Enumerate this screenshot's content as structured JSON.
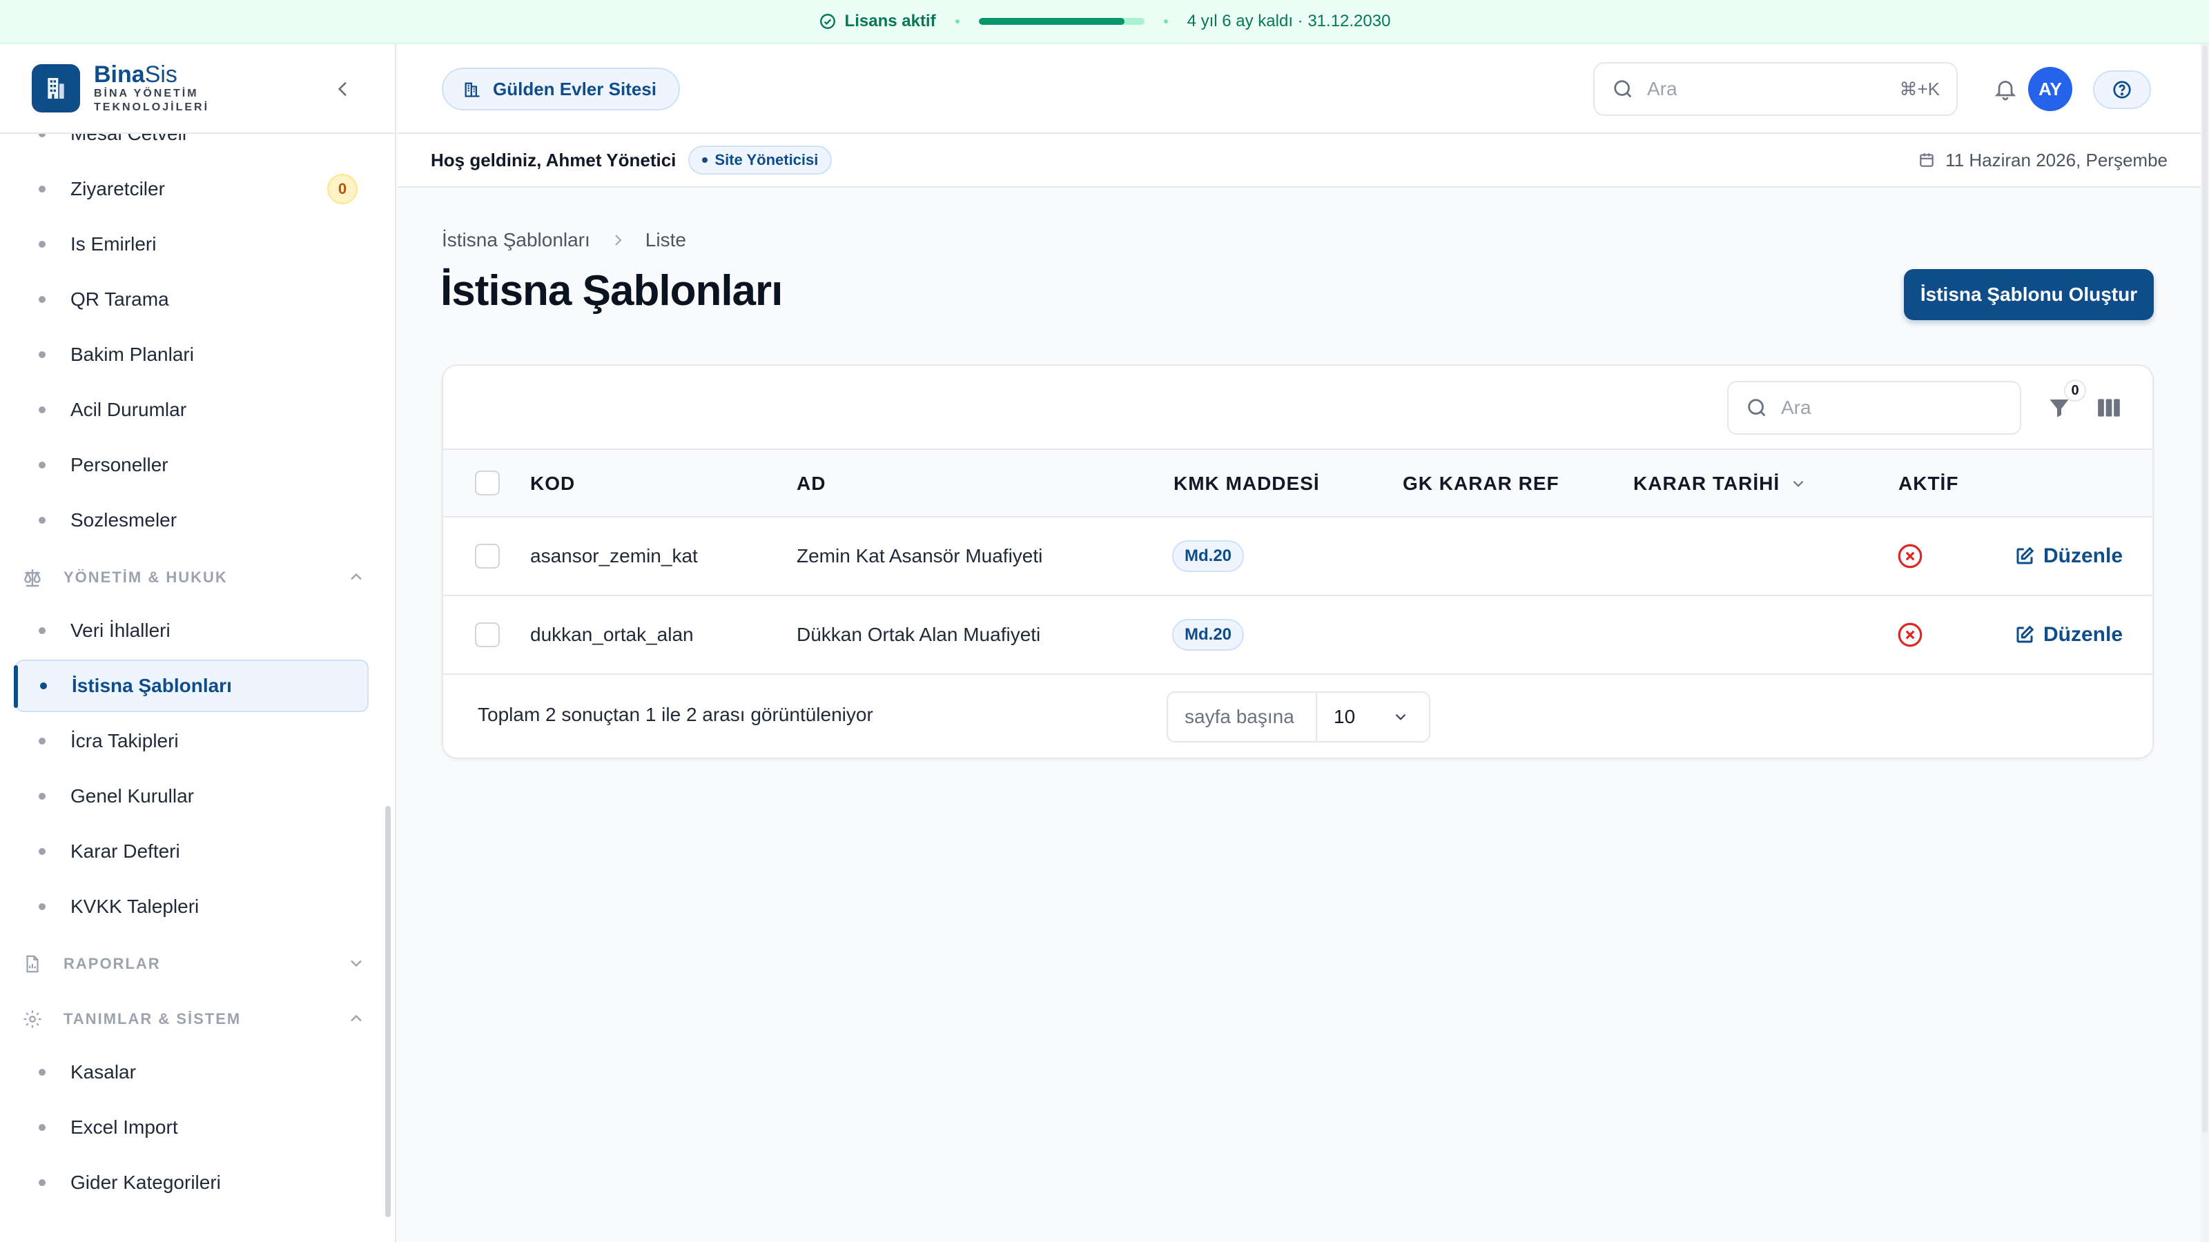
{
  "license": {
    "status": "Lisans aktif",
    "remaining": "4 yıl 6 ay kaldı · 31.12.2030",
    "progress_fraction": 0.88
  },
  "brand": {
    "name_bold": "Bina",
    "name_light": "Sis",
    "subtitle_line1": "BİNA YÖNETİM",
    "subtitle_line2": "TEKNOLOJİLERİ"
  },
  "sidebar": {
    "top_items": [
      {
        "label": "Mesai Cetveli"
      },
      {
        "label": "Ziyaretciler",
        "badge": "0"
      },
      {
        "label": "Is Emirleri"
      },
      {
        "label": "QR Tarama"
      },
      {
        "label": "Bakim Planlari"
      },
      {
        "label": "Acil Durumlar"
      },
      {
        "label": "Personeller"
      },
      {
        "label": "Sozlesmeler"
      }
    ],
    "section_yonetim": "YÖNETİM & HUKUK",
    "yonetim_items": [
      {
        "label": "Veri İhlalleri"
      },
      {
        "label": "İstisna Şablonları",
        "active": true
      },
      {
        "label": "İcra Takipleri"
      },
      {
        "label": "Genel Kurullar"
      },
      {
        "label": "Karar Defteri"
      },
      {
        "label": "KVKK Talepleri"
      }
    ],
    "section_raporlar": "RAPORLAR",
    "section_tanimlar": "TANIMLAR & SİSTEM",
    "tanimlar_items": [
      {
        "label": "Kasalar"
      },
      {
        "label": "Excel Import"
      },
      {
        "label": "Gider Kategorileri"
      }
    ]
  },
  "topbar": {
    "site_name": "Gülden Evler Sitesi",
    "search_placeholder": "Ara",
    "search_shortcut": "⌘+K",
    "avatar_initials": "AY"
  },
  "welcome": {
    "greeting": "Hoş geldiniz, Ahmet Yönetici",
    "role": "Site Yöneticisi",
    "date": "11 Haziran 2026, Perşembe"
  },
  "page": {
    "breadcrumb": [
      "İstisna Şablonları",
      "Liste"
    ],
    "title": "İstisna Şablonları",
    "create_button": "İstisna Şablonu Oluştur"
  },
  "table": {
    "search_placeholder": "Ara",
    "filter_count": "0",
    "columns": [
      "KOD",
      "AD",
      "KMK MADDESİ",
      "GK KARAR REF",
      "KARAR TARİHİ",
      "AKTİF"
    ],
    "rows": [
      {
        "kod": "asansor_zemin_kat",
        "ad": "Zemin Kat Asansör Muafiyeti",
        "kmk": "Md.20",
        "gk_ref": "",
        "karar_tarihi": "",
        "aktif": false,
        "action": "Düzenle"
      },
      {
        "kod": "dukkan_ortak_alan",
        "ad": "Dükkan Ortak Alan Muafiyeti",
        "kmk": "Md.20",
        "gk_ref": "",
        "karar_tarihi": "",
        "aktif": false,
        "action": "Düzenle"
      }
    ],
    "footer_text": "Toplam 2 sonuçtan 1 ile 2 arası görüntüleniyor",
    "per_page_label": "sayfa başına",
    "per_page_value": "10"
  },
  "colors": {
    "brand": "#0f4c8a",
    "license_green": "#059669",
    "inactive_red": "#dc2626"
  }
}
